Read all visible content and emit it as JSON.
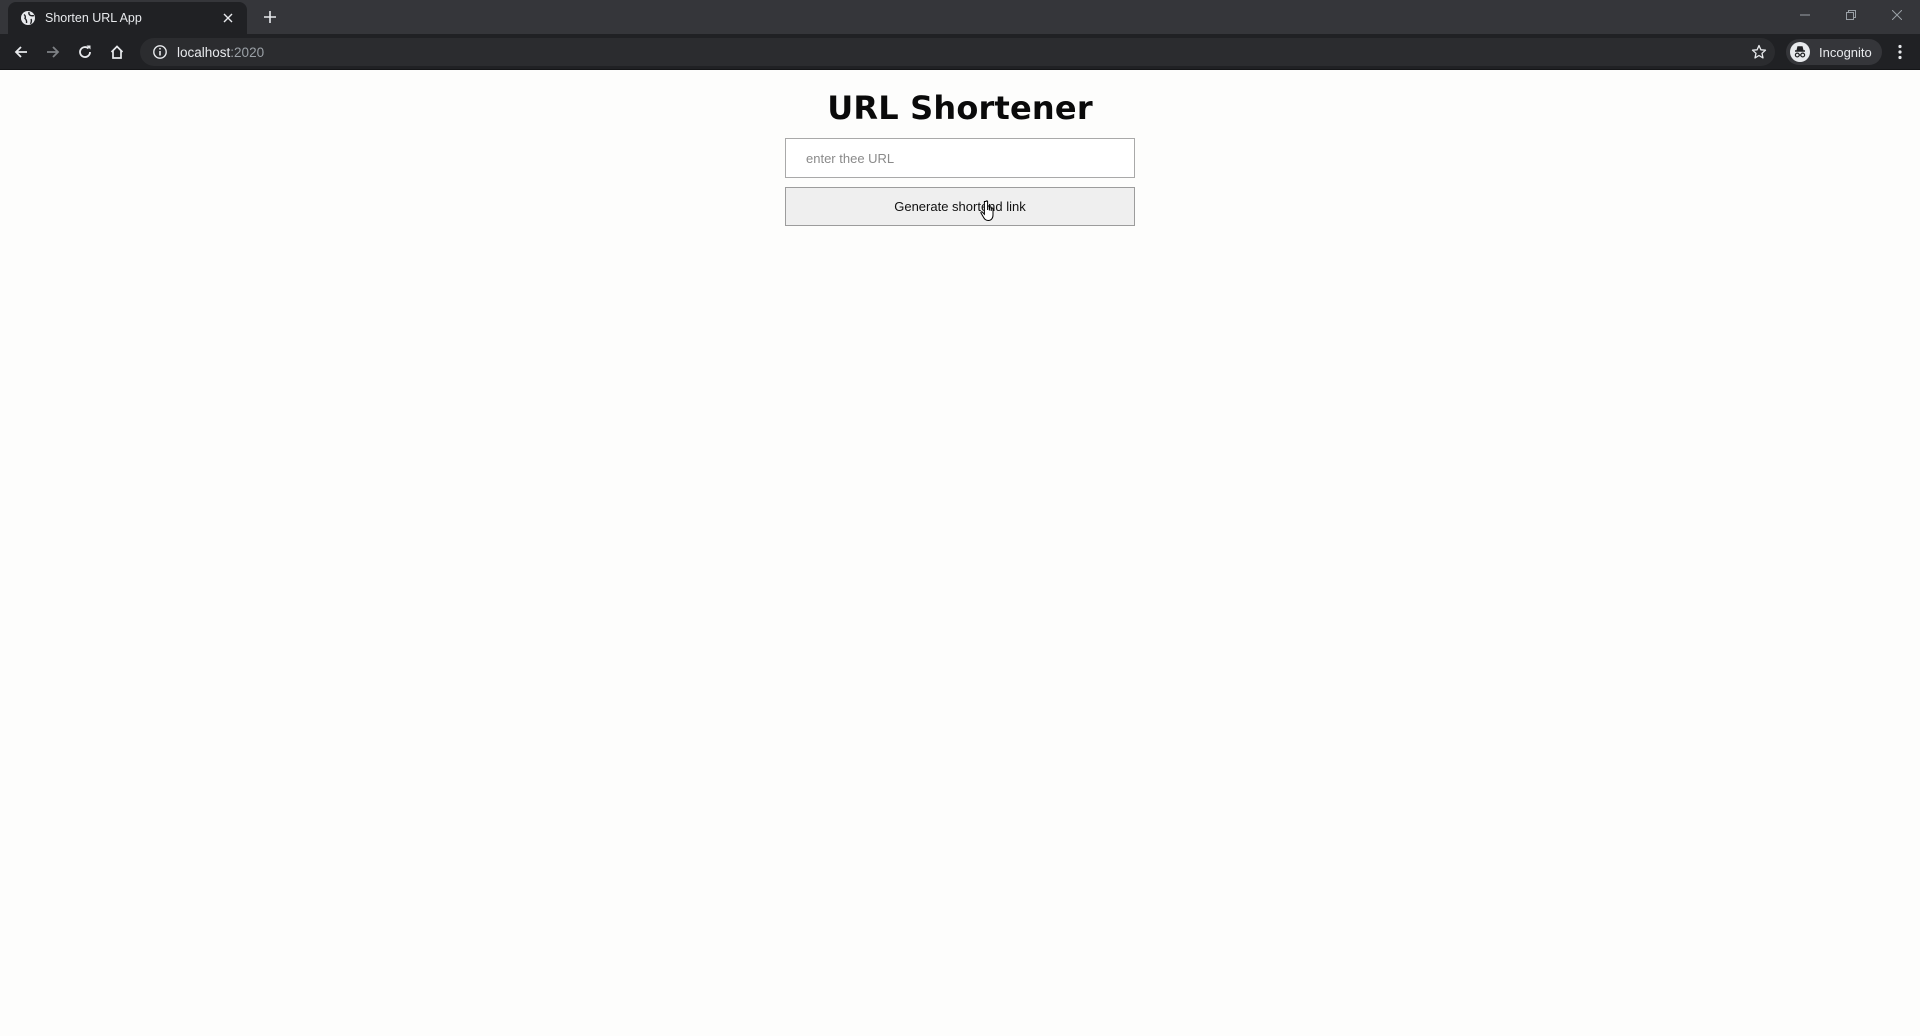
{
  "browser": {
    "tab": {
      "title": "Shorten URL App",
      "favicon": "globe-icon",
      "close_icon": "close-icon"
    },
    "new_tab_icon": "plus-icon",
    "window_controls": [
      "minimize-icon",
      "restore-icon",
      "close-icon"
    ],
    "nav": {
      "back_icon": "back-arrow-icon",
      "forward_icon": "forward-arrow-icon",
      "reload_icon": "reload-icon",
      "home_icon": "home-icon"
    },
    "address": {
      "host": "localhost",
      "port": ":2020",
      "info_icon": "info-icon",
      "bookmark_icon": "star-icon"
    },
    "profile": {
      "label": "Incognito",
      "icon": "incognito-icon"
    },
    "menu_icon": "kebab-menu-icon"
  },
  "app": {
    "title": "URL Shortener",
    "url_input": {
      "value": "",
      "placeholder": "enter thee URL"
    },
    "generate_button_label": "Generate shortend link"
  },
  "colors": {
    "tabstrip": "#35363a",
    "toolbar": "#202124",
    "page_background": "#fdfdfc",
    "button_background": "#efefef"
  }
}
